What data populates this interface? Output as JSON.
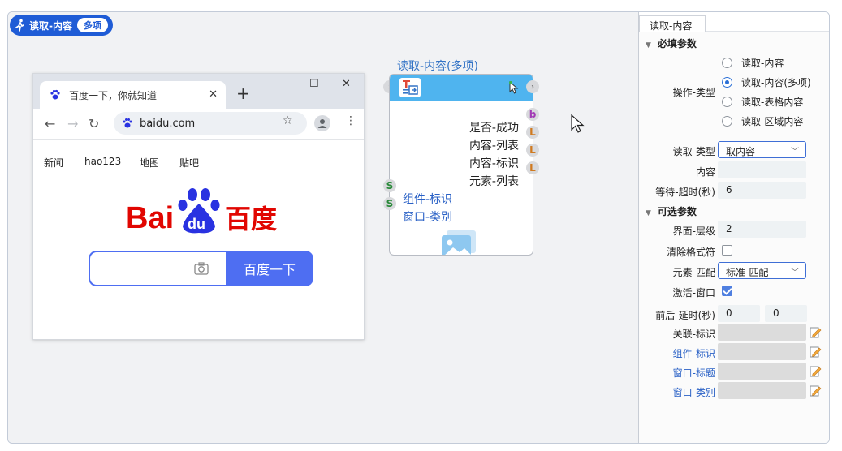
{
  "canvas": {
    "tag_title": "读取-内容",
    "tag_badge": "多项"
  },
  "browser": {
    "tab_title": "百度一下，你就知道",
    "tab_close": "✕",
    "new_tab": "+",
    "minimize": "—",
    "maximize": "☐",
    "close": "✕",
    "back": "←",
    "forward": "→",
    "reload": "↻",
    "url": "baidu.com",
    "star": "☆",
    "menu": "⋮",
    "links": [
      "新闻",
      "hao123",
      "地图",
      "贴吧"
    ],
    "logo_text_left": "Bai",
    "logo_text_du": "du",
    "logo_text_right": "百度",
    "search_button": "百度一下"
  },
  "node": {
    "title": "读取-内容(多项)",
    "outputs": [
      {
        "label": "是否-成功",
        "badge": "b",
        "color": "#a23bb5"
      },
      {
        "label": "内容-列表",
        "badge": "L",
        "color": "#d07a1f"
      },
      {
        "label": "内容-标识",
        "badge": "L",
        "color": "#d07a1f"
      },
      {
        "label": "元素-列表",
        "badge": "L",
        "color": "#d07a1f"
      }
    ],
    "inputs": [
      {
        "label": "组件-标识",
        "badge": "S"
      },
      {
        "label": "窗口-类别",
        "badge": "S"
      }
    ],
    "left_port": "›",
    "right_port": "›"
  },
  "panel": {
    "tab": "读取-内容",
    "required_section": "必填参数",
    "operation_type_label": "操作-类型",
    "operation_options": [
      {
        "label": "读取-内容",
        "selected": false
      },
      {
        "label": "读取-内容(多项)",
        "selected": true
      },
      {
        "label": "读取-表格内容",
        "selected": false
      },
      {
        "label": "读取-区域内容",
        "selected": false
      }
    ],
    "read_type_label": "读取-类型",
    "read_type_value": "取内容",
    "content_label": "内容",
    "content_value": "",
    "wait_timeout_label": "等待-超时(秒)",
    "wait_timeout_value": "6",
    "optional_section": "可选参数",
    "ui_level_label": "界面-层级",
    "ui_level_value": "2",
    "clear_format_label": "清除格式符",
    "clear_format_checked": false,
    "element_match_label": "元素-匹配",
    "element_match_value": "标准-匹配",
    "activate_window_label": "激活-窗口",
    "activate_window_checked": true,
    "delay_label": "前后-延时(秒)",
    "delay_before": "0",
    "delay_after": "0",
    "related_id_label": "关联-标识",
    "component_id_label": "组件-标识",
    "window_title_label": "窗口-标题",
    "window_class_label": "窗口-类别"
  }
}
